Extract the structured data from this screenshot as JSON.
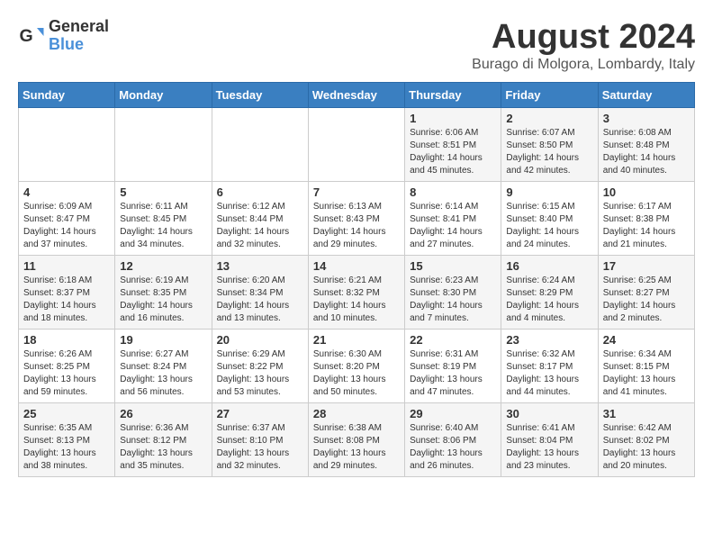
{
  "logo": {
    "general": "General",
    "blue": "Blue"
  },
  "title": {
    "month": "August 2024",
    "location": "Burago di Molgora, Lombardy, Italy"
  },
  "headers": [
    "Sunday",
    "Monday",
    "Tuesday",
    "Wednesday",
    "Thursday",
    "Friday",
    "Saturday"
  ],
  "weeks": [
    [
      {
        "day": "",
        "info": ""
      },
      {
        "day": "",
        "info": ""
      },
      {
        "day": "",
        "info": ""
      },
      {
        "day": "",
        "info": ""
      },
      {
        "day": "1",
        "info": "Sunrise: 6:06 AM\nSunset: 8:51 PM\nDaylight: 14 hours\nand 45 minutes."
      },
      {
        "day": "2",
        "info": "Sunrise: 6:07 AM\nSunset: 8:50 PM\nDaylight: 14 hours\nand 42 minutes."
      },
      {
        "day": "3",
        "info": "Sunrise: 6:08 AM\nSunset: 8:48 PM\nDaylight: 14 hours\nand 40 minutes."
      }
    ],
    [
      {
        "day": "4",
        "info": "Sunrise: 6:09 AM\nSunset: 8:47 PM\nDaylight: 14 hours\nand 37 minutes."
      },
      {
        "day": "5",
        "info": "Sunrise: 6:11 AM\nSunset: 8:45 PM\nDaylight: 14 hours\nand 34 minutes."
      },
      {
        "day": "6",
        "info": "Sunrise: 6:12 AM\nSunset: 8:44 PM\nDaylight: 14 hours\nand 32 minutes."
      },
      {
        "day": "7",
        "info": "Sunrise: 6:13 AM\nSunset: 8:43 PM\nDaylight: 14 hours\nand 29 minutes."
      },
      {
        "day": "8",
        "info": "Sunrise: 6:14 AM\nSunset: 8:41 PM\nDaylight: 14 hours\nand 27 minutes."
      },
      {
        "day": "9",
        "info": "Sunrise: 6:15 AM\nSunset: 8:40 PM\nDaylight: 14 hours\nand 24 minutes."
      },
      {
        "day": "10",
        "info": "Sunrise: 6:17 AM\nSunset: 8:38 PM\nDaylight: 14 hours\nand 21 minutes."
      }
    ],
    [
      {
        "day": "11",
        "info": "Sunrise: 6:18 AM\nSunset: 8:37 PM\nDaylight: 14 hours\nand 18 minutes."
      },
      {
        "day": "12",
        "info": "Sunrise: 6:19 AM\nSunset: 8:35 PM\nDaylight: 14 hours\nand 16 minutes."
      },
      {
        "day": "13",
        "info": "Sunrise: 6:20 AM\nSunset: 8:34 PM\nDaylight: 14 hours\nand 13 minutes."
      },
      {
        "day": "14",
        "info": "Sunrise: 6:21 AM\nSunset: 8:32 PM\nDaylight: 14 hours\nand 10 minutes."
      },
      {
        "day": "15",
        "info": "Sunrise: 6:23 AM\nSunset: 8:30 PM\nDaylight: 14 hours\nand 7 minutes."
      },
      {
        "day": "16",
        "info": "Sunrise: 6:24 AM\nSunset: 8:29 PM\nDaylight: 14 hours\nand 4 minutes."
      },
      {
        "day": "17",
        "info": "Sunrise: 6:25 AM\nSunset: 8:27 PM\nDaylight: 14 hours\nand 2 minutes."
      }
    ],
    [
      {
        "day": "18",
        "info": "Sunrise: 6:26 AM\nSunset: 8:25 PM\nDaylight: 13 hours\nand 59 minutes."
      },
      {
        "day": "19",
        "info": "Sunrise: 6:27 AM\nSunset: 8:24 PM\nDaylight: 13 hours\nand 56 minutes."
      },
      {
        "day": "20",
        "info": "Sunrise: 6:29 AM\nSunset: 8:22 PM\nDaylight: 13 hours\nand 53 minutes."
      },
      {
        "day": "21",
        "info": "Sunrise: 6:30 AM\nSunset: 8:20 PM\nDaylight: 13 hours\nand 50 minutes."
      },
      {
        "day": "22",
        "info": "Sunrise: 6:31 AM\nSunset: 8:19 PM\nDaylight: 13 hours\nand 47 minutes."
      },
      {
        "day": "23",
        "info": "Sunrise: 6:32 AM\nSunset: 8:17 PM\nDaylight: 13 hours\nand 44 minutes."
      },
      {
        "day": "24",
        "info": "Sunrise: 6:34 AM\nSunset: 8:15 PM\nDaylight: 13 hours\nand 41 minutes."
      }
    ],
    [
      {
        "day": "25",
        "info": "Sunrise: 6:35 AM\nSunset: 8:13 PM\nDaylight: 13 hours\nand 38 minutes."
      },
      {
        "day": "26",
        "info": "Sunrise: 6:36 AM\nSunset: 8:12 PM\nDaylight: 13 hours\nand 35 minutes."
      },
      {
        "day": "27",
        "info": "Sunrise: 6:37 AM\nSunset: 8:10 PM\nDaylight: 13 hours\nand 32 minutes."
      },
      {
        "day": "28",
        "info": "Sunrise: 6:38 AM\nSunset: 8:08 PM\nDaylight: 13 hours\nand 29 minutes."
      },
      {
        "day": "29",
        "info": "Sunrise: 6:40 AM\nSunset: 8:06 PM\nDaylight: 13 hours\nand 26 minutes."
      },
      {
        "day": "30",
        "info": "Sunrise: 6:41 AM\nSunset: 8:04 PM\nDaylight: 13 hours\nand 23 minutes."
      },
      {
        "day": "31",
        "info": "Sunrise: 6:42 AM\nSunset: 8:02 PM\nDaylight: 13 hours\nand 20 minutes."
      }
    ]
  ]
}
